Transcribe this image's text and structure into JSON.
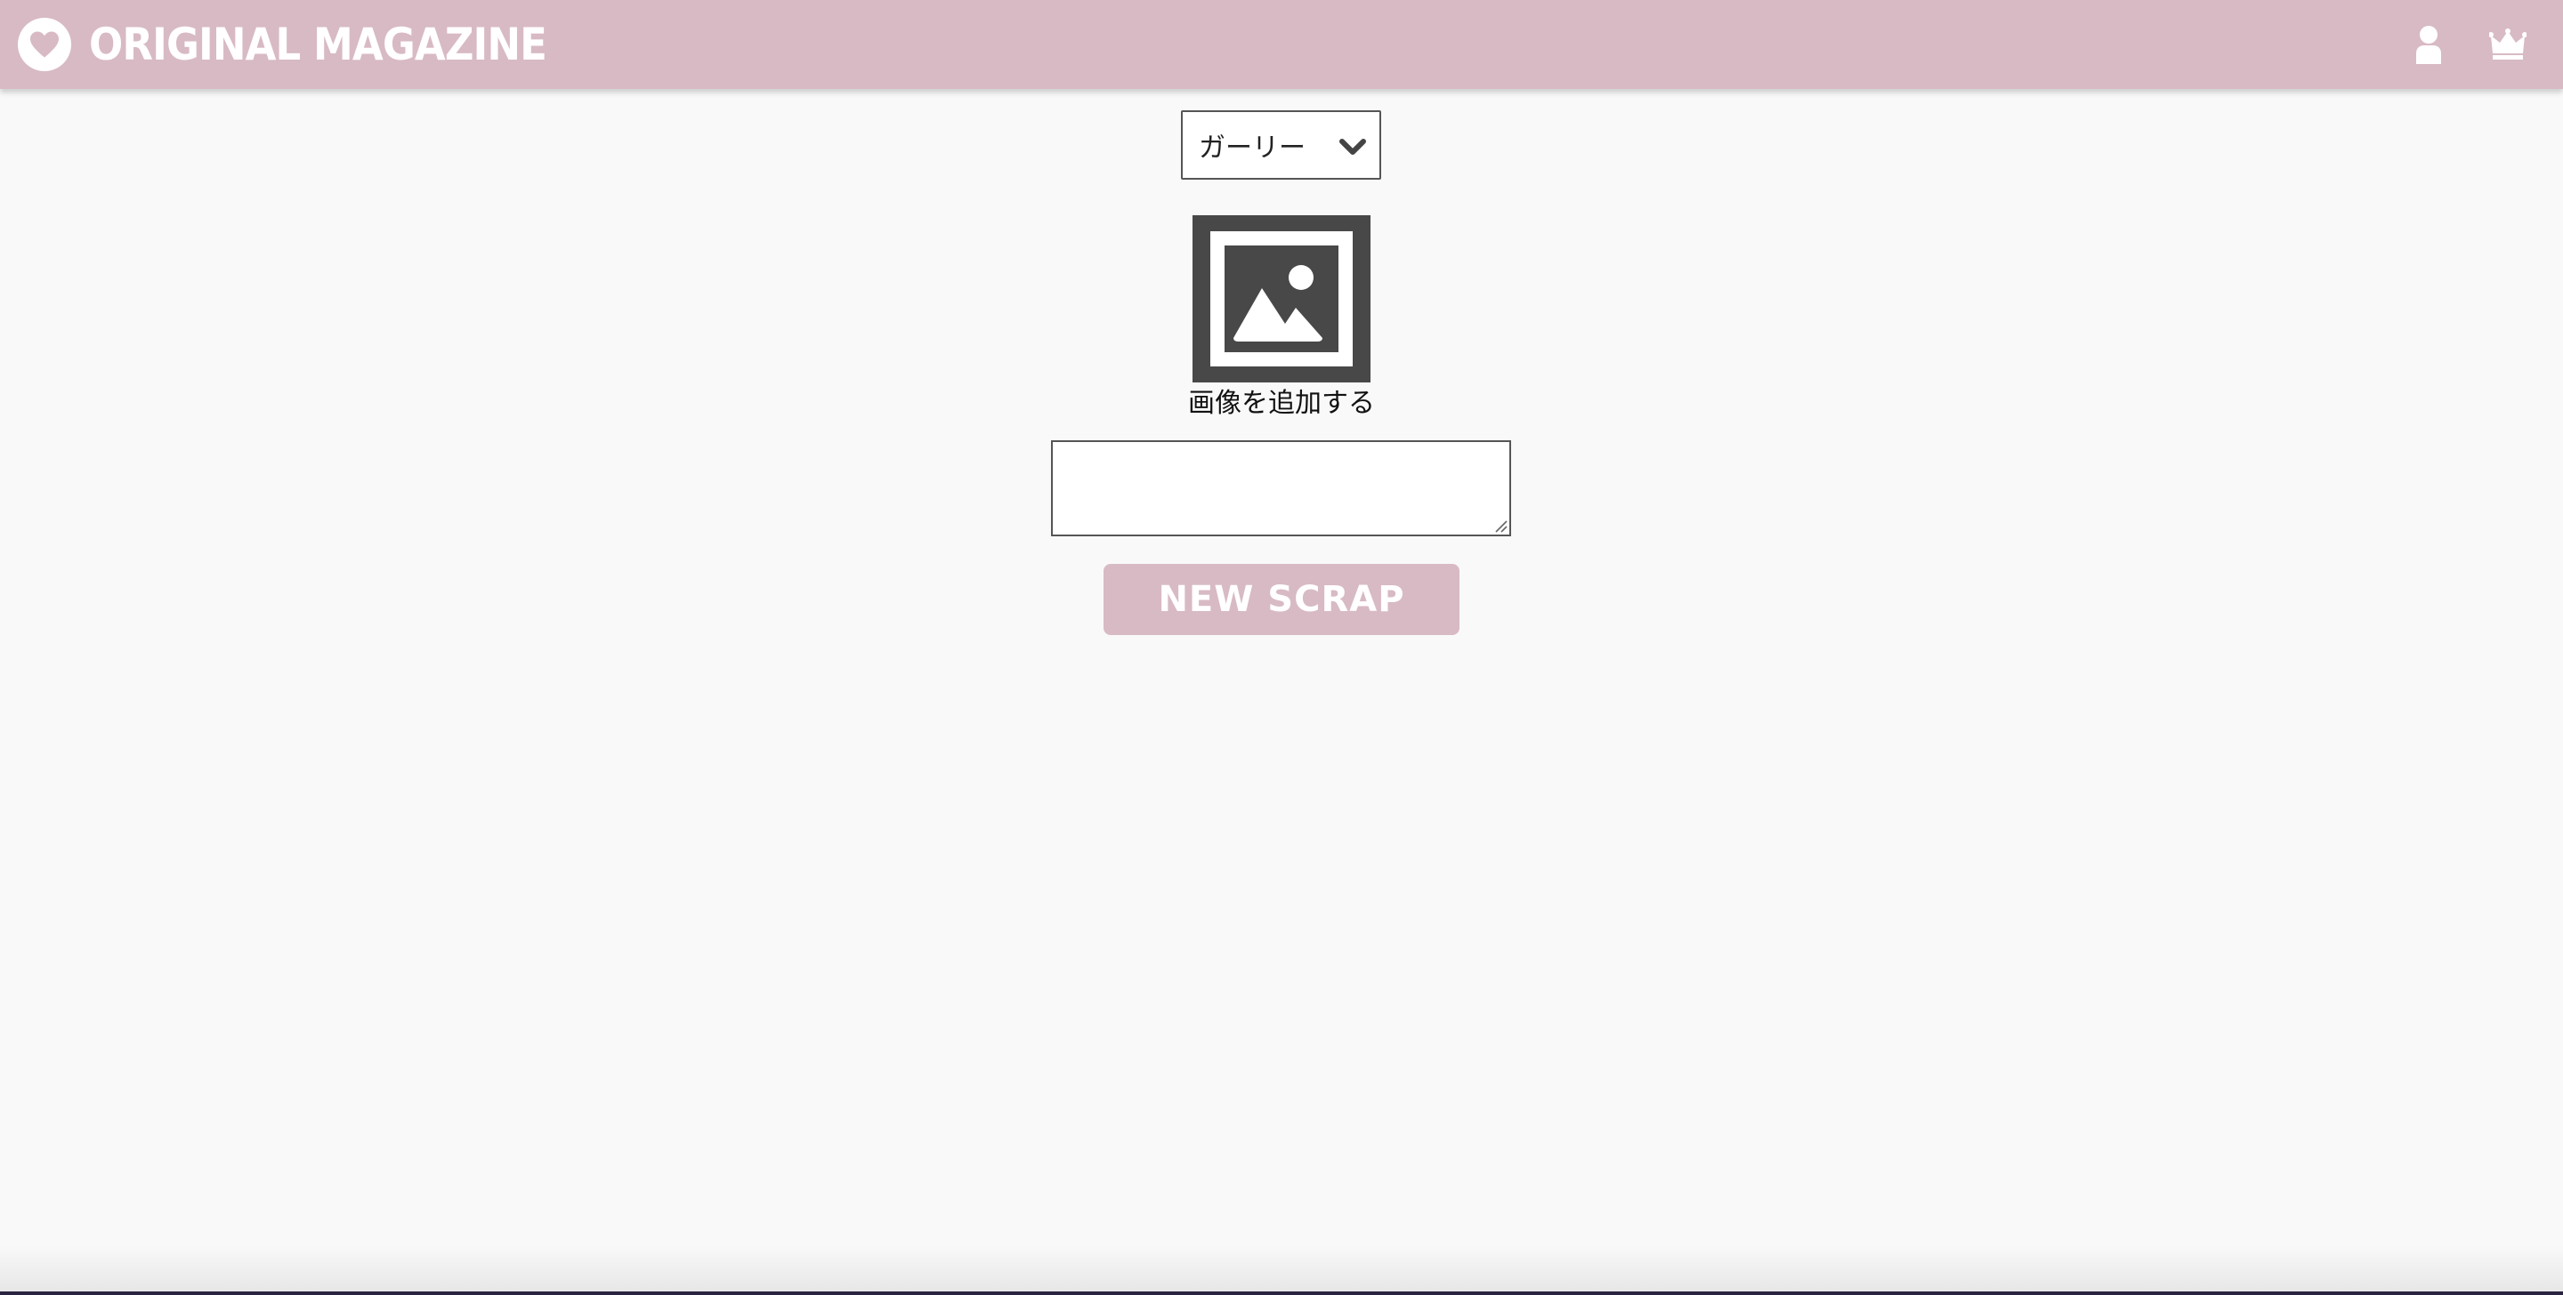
{
  "header": {
    "brand": "ORIGINAL MAGAZINE",
    "brand_color": "#d8bac4",
    "icons": [
      "heart-icon",
      "user-icon",
      "crown-icon"
    ]
  },
  "form": {
    "category_select": {
      "selected": "ガーリー"
    },
    "image_picker": {
      "caption": "画像を追加する",
      "icon": "image-placeholder-icon"
    },
    "text_input": {
      "value": ""
    },
    "submit_label": "NEW SCRAP"
  },
  "colors": {
    "accent": "#d8bac4",
    "background": "#f9f9f9",
    "icon_dark": "#484848"
  }
}
